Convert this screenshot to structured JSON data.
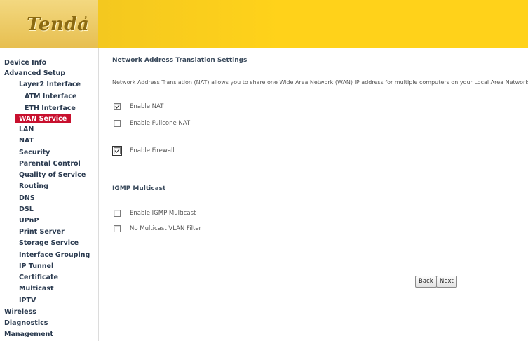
{
  "header": {
    "logo": "Tenda",
    "logo_mark": "’"
  },
  "sidebar": {
    "items": [
      {
        "label": "Device Info",
        "level": 0
      },
      {
        "label": "Advanced Setup",
        "level": 0
      },
      {
        "label": "Layer2 Interface",
        "level": 1
      },
      {
        "label": "ATM Interface",
        "level": 2
      },
      {
        "label": "ETH Interface",
        "level": 2
      },
      {
        "label": "WAN Service",
        "level": 1,
        "active": true
      },
      {
        "label": "LAN",
        "level": 1
      },
      {
        "label": "NAT",
        "level": 1
      },
      {
        "label": "Security",
        "level": 1
      },
      {
        "label": "Parental Control",
        "level": 1
      },
      {
        "label": "Quality of Service",
        "level": 1
      },
      {
        "label": "Routing",
        "level": 1
      },
      {
        "label": "DNS",
        "level": 1
      },
      {
        "label": "DSL",
        "level": 1
      },
      {
        "label": "UPnP",
        "level": 1
      },
      {
        "label": "Print Server",
        "level": 1
      },
      {
        "label": "Storage Service",
        "level": 1
      },
      {
        "label": "Interface Grouping",
        "level": 1
      },
      {
        "label": "IP Tunnel",
        "level": 1
      },
      {
        "label": "Certificate",
        "level": 1
      },
      {
        "label": "Multicast",
        "level": 1
      },
      {
        "label": "IPTV",
        "level": 1
      },
      {
        "label": "Wireless",
        "level": 0
      },
      {
        "label": "Diagnostics",
        "level": 0
      },
      {
        "label": "Management",
        "level": 0
      }
    ]
  },
  "main": {
    "title": "Network Address Translation Settings",
    "description": "Network Address Translation (NAT) allows you to share one Wide Area Network (WAN) IP address for multiple computers on your Local Area Network (LAN).",
    "options": {
      "enable_nat": {
        "label": "Enable NAT",
        "checked": true
      },
      "enable_fullcone_nat": {
        "label": "Enable Fullcone NAT",
        "checked": false
      },
      "enable_firewall": {
        "label": "Enable Firewall",
        "checked": true
      }
    },
    "igmp_title": "IGMP Multicast",
    "igmp_options": {
      "enable_igmp_multicast": {
        "label": "Enable IGMP Multicast",
        "checked": false
      },
      "no_multicast_vlan_filter": {
        "label": "No Multicast VLAN Filter",
        "checked": false
      }
    },
    "back_label": "Back",
    "next_label": "Next"
  },
  "colors": {
    "header": "#ffd21a",
    "active_nav": "#c8102e",
    "nav_text": "#2a3a4f"
  }
}
